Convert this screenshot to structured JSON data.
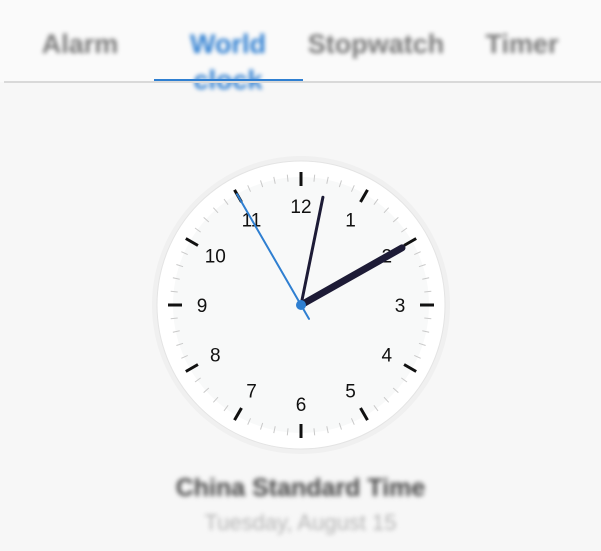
{
  "tabs": {
    "alarm": "Alarm",
    "world_clock": "World clock",
    "stopwatch": "Stopwatch",
    "timer": "Timer"
  },
  "clock": {
    "numerals": [
      "12",
      "1",
      "2",
      "3",
      "4",
      "5",
      "6",
      "7",
      "8",
      "9",
      "10",
      "11"
    ],
    "time": {
      "hours": 2,
      "minutes": 1,
      "seconds": 55
    }
  },
  "timezone": {
    "name": "China Standard Time",
    "date": "Tuesday, August 15"
  },
  "colors": {
    "accent": "#2f7fd1",
    "hands": "#1d1b36"
  }
}
